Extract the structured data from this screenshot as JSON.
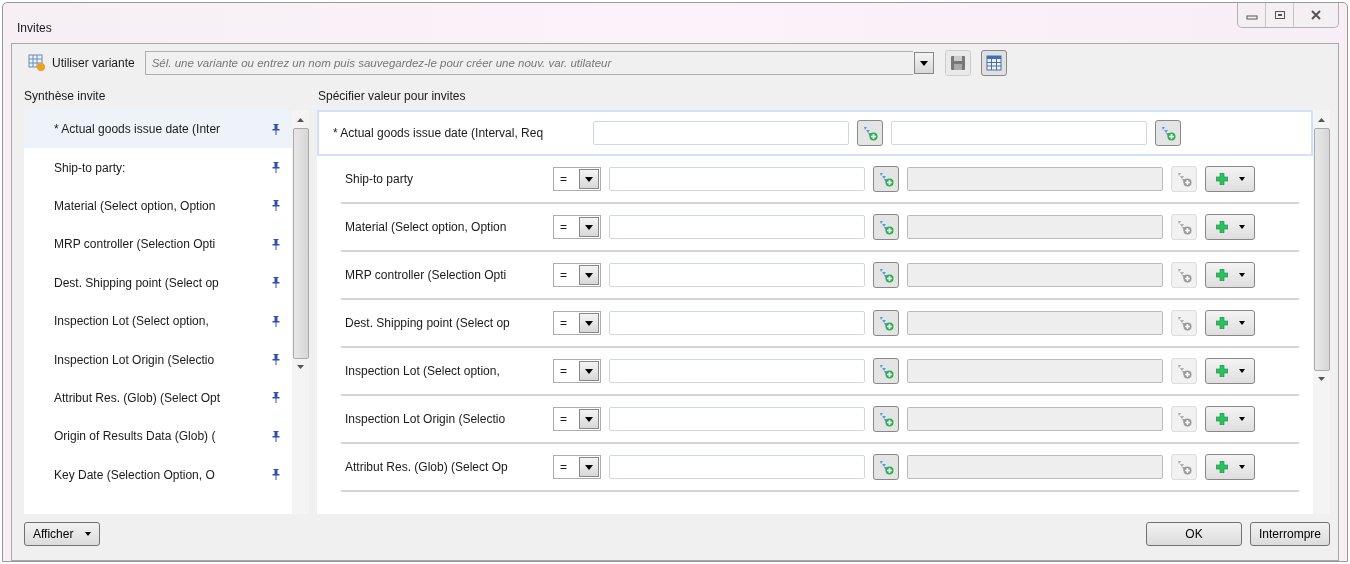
{
  "window": {
    "title": "Invites"
  },
  "variant": {
    "label": "Utiliser variante",
    "placeholder": "Sél. une variante ou entrez un nom puis sauvegardez-le pour créer une nouv. var. utilateur"
  },
  "summary": {
    "heading": "Synthèse invite",
    "items": [
      {
        "label": "* Actual goods issue date (Inter",
        "selected": true
      },
      {
        "label": "Ship-to party:",
        "selected": false
      },
      {
        "label": "Material (Select option, Option",
        "selected": false
      },
      {
        "label": "MRP controller (Selection Opti",
        "selected": false
      },
      {
        "label": "Dest. Shipping point (Select op",
        "selected": false
      },
      {
        "label": "Inspection Lot (Select option,",
        "selected": false
      },
      {
        "label": "Inspection Lot Origin (Selectio",
        "selected": false
      },
      {
        "label": "Attribut Res. (Glob) (Select Opt",
        "selected": false
      },
      {
        "label": "Origin of Results Data (Glob) (",
        "selected": false
      },
      {
        "label": "Key Date (Selection Option, O",
        "selected": false
      }
    ]
  },
  "values": {
    "heading": "Spécifier valeur pour invites",
    "prompts": [
      {
        "kind": "interval",
        "label": "* Actual goods issue date (Interval, Req",
        "selected": true
      },
      {
        "kind": "select",
        "label": "Ship-to party",
        "operator": "=",
        "selected": false
      },
      {
        "kind": "select",
        "label": "Material (Select option, Option",
        "operator": "=",
        "selected": false
      },
      {
        "kind": "select",
        "label": "MRP controller (Selection Opti",
        "operator": "=",
        "selected": false
      },
      {
        "kind": "select",
        "label": "Dest. Shipping point (Select op",
        "operator": "=",
        "selected": false
      },
      {
        "kind": "select",
        "label": "Inspection Lot (Select option,",
        "operator": "=",
        "selected": false
      },
      {
        "kind": "select",
        "label": "Inspection Lot Origin (Selectio",
        "operator": "=",
        "selected": false
      },
      {
        "kind": "select",
        "label": "Attribut Res. (Glob) (Select Op",
        "operator": "=",
        "selected": false
      }
    ]
  },
  "footer": {
    "menu": "Afficher",
    "buttons": [
      "OK",
      "Interrompre"
    ]
  }
}
